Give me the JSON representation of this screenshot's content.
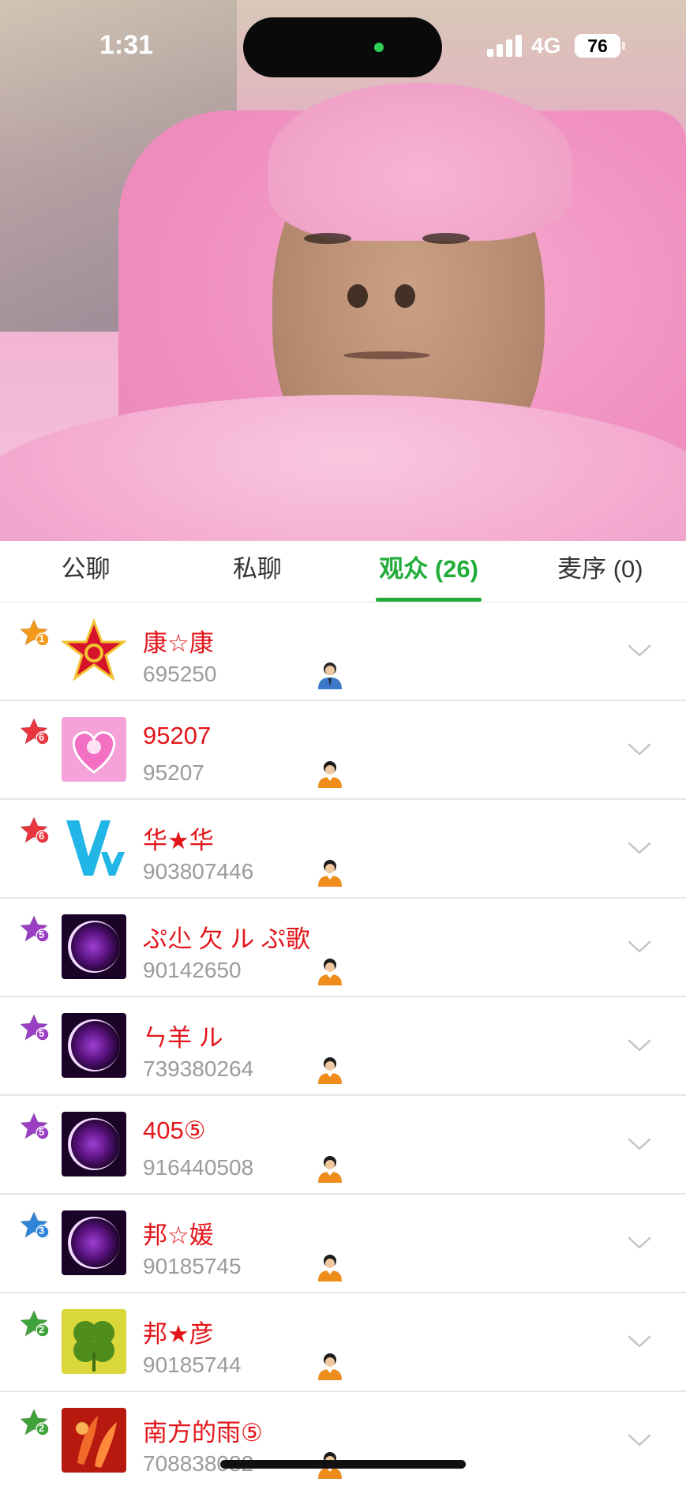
{
  "status_bar": {
    "time": "1:31",
    "network": "4G",
    "battery": "76"
  },
  "tabs": [
    {
      "label": "公聊",
      "active": false
    },
    {
      "label": "私聊",
      "active": false
    },
    {
      "label": "观众 (26)",
      "active": true
    },
    {
      "label": "麦序 (0)",
      "active": false
    }
  ],
  "colors": {
    "accent": "#22ad3a",
    "name": "#e4151a",
    "id": "#9b9b9b"
  },
  "audience": [
    {
      "rank": "1",
      "rank_color": "#f39a1c",
      "name": "康☆康",
      "id": "695250",
      "avatar": "red-star-emblem",
      "person": "suit"
    },
    {
      "rank": "6",
      "rank_color": "#e9353f",
      "name": "95207",
      "id": "95207",
      "avatar": "pink-love-heart",
      "person": "orange"
    },
    {
      "rank": "6",
      "rank_color": "#e9353f",
      "name": "华★华",
      "id": "903807446",
      "avatar": "blue-v-logo",
      "person": "orange"
    },
    {
      "rank": "5",
      "rank_color": "#9a3ec4",
      "name": "ぷ尐  欠 ル ぷ歌",
      "id": "90142650",
      "avatar": "purple-eclipse",
      "person": "orange"
    },
    {
      "rank": "5",
      "rank_color": "#9a3ec4",
      "name": "ㄣ羊 ル",
      "id": "739380264",
      "avatar": "purple-eclipse",
      "person": "orange"
    },
    {
      "rank": "5",
      "rank_color": "#9a3ec4",
      "name": "405⑤",
      "id": "916440508",
      "avatar": "purple-eclipse",
      "person": "orange"
    },
    {
      "rank": "3",
      "rank_color": "#2f86d8",
      "name": "邦☆媛",
      "id": "90185745",
      "avatar": "purple-eclipse",
      "person": "orange"
    },
    {
      "rank": "2",
      "rank_color": "#3fa23a",
      "name": "邦★彦",
      "id": "90185744",
      "avatar": "green-clover",
      "person": "orange"
    },
    {
      "rank": "2",
      "rank_color": "#3fa23a",
      "name": "南方的雨⑤",
      "id": "708838082",
      "avatar": "red-flowers",
      "person": "orange"
    }
  ]
}
